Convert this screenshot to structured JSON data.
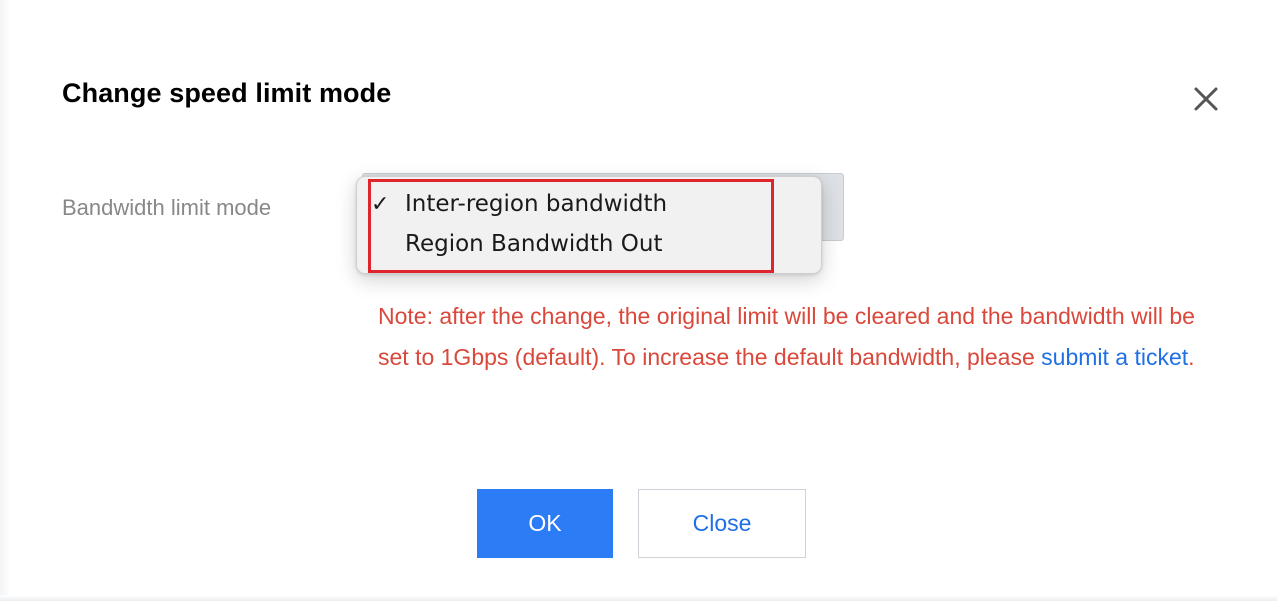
{
  "dialog": {
    "title": "Change speed limit mode",
    "close_icon": "close-icon"
  },
  "form": {
    "field_label": "Bandwidth limit mode",
    "dropdown": {
      "selected_value": "Inter-region bandwidth",
      "options": [
        {
          "label": "Inter-region bandwidth",
          "checked": true,
          "check_mark": "✓"
        },
        {
          "label": "Region Bandwidth Out",
          "checked": false,
          "check_mark": ""
        }
      ]
    },
    "note": {
      "text_before_link": "Note: after the change, the original limit will be cleared and the bandwidth will be set to 1Gbps (default). To increase the default bandwidth, please ",
      "link_text": "submit a ticket",
      "text_after_link": "."
    }
  },
  "buttons": {
    "ok_label": "OK",
    "close_label": "Close"
  },
  "colors": {
    "primary": "#2b7cf5",
    "note_text": "#d9483b",
    "link": "#1f6fe5",
    "highlight_annotation": "#e0242c"
  }
}
